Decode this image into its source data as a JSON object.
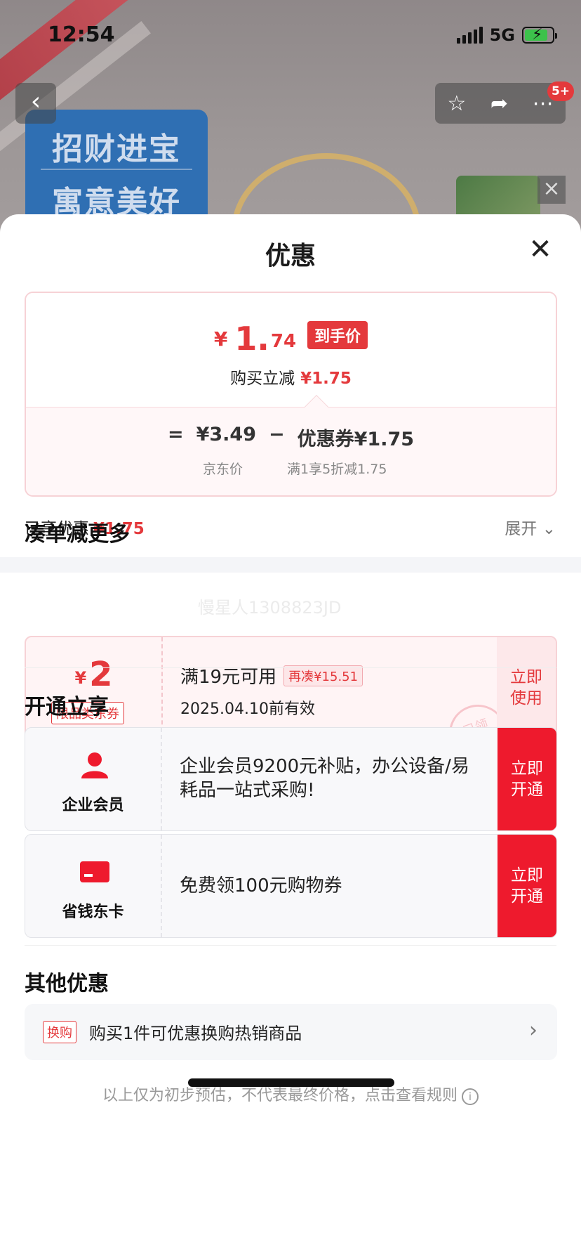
{
  "status_bar": {
    "time": "12:54",
    "network": "5G"
  },
  "background_page": {
    "promo_line1": "招财进宝",
    "promo_line2": "寓意美好",
    "badge_count": "5+"
  },
  "sheet": {
    "title": "优惠",
    "price_card": {
      "final_currency": "¥",
      "final_integer": "1.",
      "final_decimal": "74",
      "final_tag": "到手价",
      "instant_label": "购买立减",
      "instant_value": "¥1.75",
      "formula_equals": "=",
      "jd_price": "¥3.49",
      "formula_minus": "−",
      "coupon_part": "优惠券¥1.75",
      "jd_price_label": "京东价",
      "coupon_rule": "满1享5折减1.75"
    },
    "enjoyed_label": "已享优惠",
    "enjoyed_value": "¥1.75",
    "expand_label": "展开",
    "collect_section": {
      "title": "凑单减更多",
      "watermark": "慢星人1308823JD",
      "coupon": {
        "currency": "¥",
        "amount": "2",
        "type": "限品类东券",
        "condition": "满19元可用",
        "more_needed": "再凑¥15.51",
        "valid_until": "2025.04.10前有效",
        "action_line1": "立即",
        "action_line2": "使用",
        "stamp": "已领"
      }
    },
    "open_section": {
      "title": "开通立享",
      "items": [
        {
          "name": "企业会员",
          "desc": "企业会员9200元补贴，办公设备/易耗品一站式采购!",
          "action_line1": "立即",
          "action_line2": "开通",
          "icon": "user-icon"
        },
        {
          "name": "省钱东卡",
          "desc": "免费领100元购物券",
          "action_line1": "立即",
          "action_line2": "开通",
          "icon": "card-icon"
        }
      ]
    },
    "other_section": {
      "title": "其他优惠",
      "trade_tag": "换购",
      "trade_text": "购买1件可优惠换购热销商品"
    },
    "footer_note": "以上仅为初步预估，不代表最终价格，点击查看规则"
  },
  "colors": {
    "accent": "#e4393c",
    "action_red": "#ee1a2d"
  }
}
